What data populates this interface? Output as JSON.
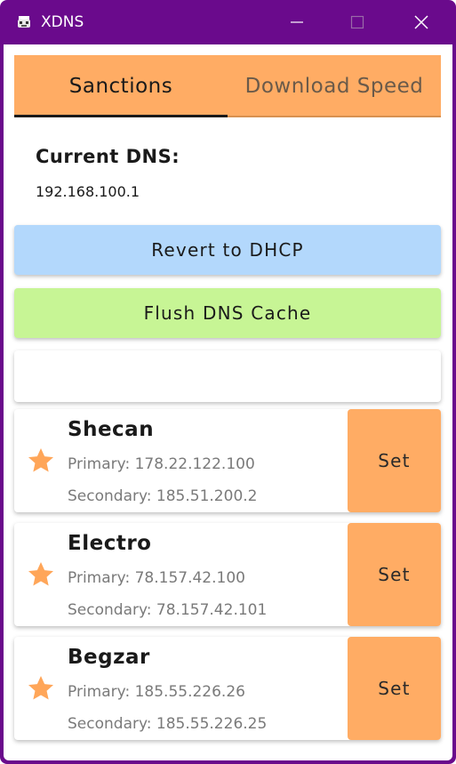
{
  "window": {
    "title": "XDNS",
    "icon": "xdns-app-icon",
    "accent_color": "#6a0a8c"
  },
  "tabs": [
    {
      "label": "Sanctions",
      "active": true
    },
    {
      "label": "Download Speed",
      "active": false
    }
  ],
  "current_dns": {
    "label": "Current DNS:",
    "value": "192.168.100.1"
  },
  "actions": {
    "revert_label": "Revert to DHCP",
    "revert_color": "#b3d8fc",
    "flush_label": "Flush DNS Cache",
    "flush_color": "#c7f595"
  },
  "search": {
    "value": "",
    "placeholder": ""
  },
  "servers": [
    {
      "name": "Shecan",
      "primary": "Primary: 178.22.122.100",
      "secondary": "Secondary: 185.51.200.2",
      "favorite": true,
      "set_label": "Set"
    },
    {
      "name": "Electro",
      "primary": "Primary: 78.157.42.100",
      "secondary": "Secondary: 78.157.42.101",
      "favorite": true,
      "set_label": "Set"
    },
    {
      "name": "Begzar",
      "primary": "Primary: 185.55.226.26",
      "secondary": "Secondary: 185.55.226.25",
      "favorite": true,
      "set_label": "Set"
    }
  ],
  "theme": {
    "tab_color": "#ffac64",
    "star_color": "#ffa659"
  }
}
